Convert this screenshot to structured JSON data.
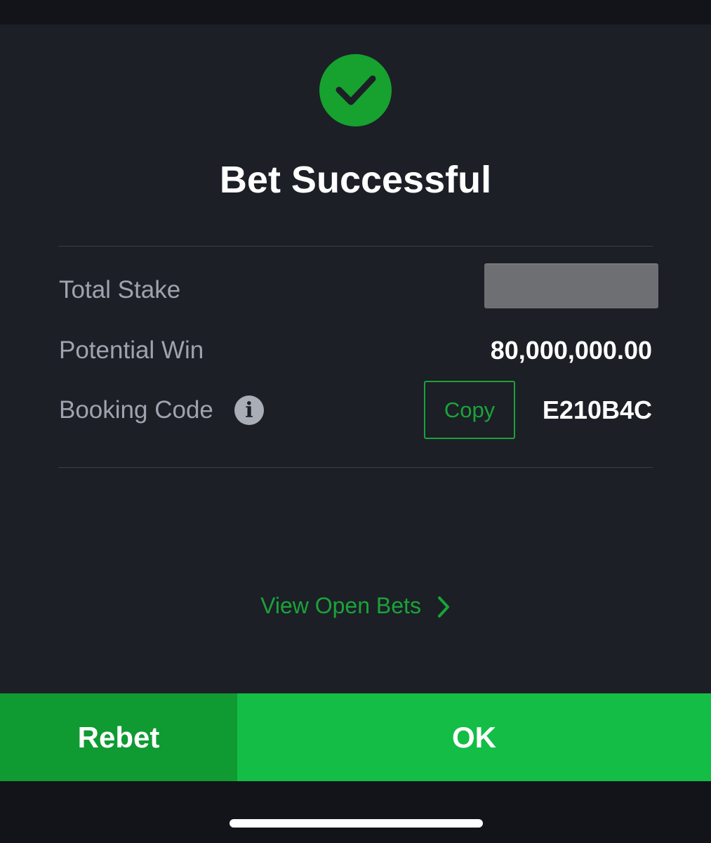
{
  "status": {
    "icon": "checkmark-circle-icon",
    "title": "Bet Successful"
  },
  "details": {
    "total_stake_label": "Total Stake",
    "potential_win_label": "Potential Win",
    "potential_win_value": "80,000,000.00",
    "booking_code_label": "Booking Code",
    "booking_code_value": "E210B4C",
    "copy_label": "Copy",
    "info_glyph": "i"
  },
  "links": {
    "view_open_bets": "View Open Bets"
  },
  "actions": {
    "rebet_label": "Rebet",
    "ok_label": "OK"
  },
  "colors": {
    "background": "#1c1f26",
    "accent_green": "#14bd46",
    "rebet_green": "#0f9a32",
    "link_green": "#1aa33a"
  }
}
